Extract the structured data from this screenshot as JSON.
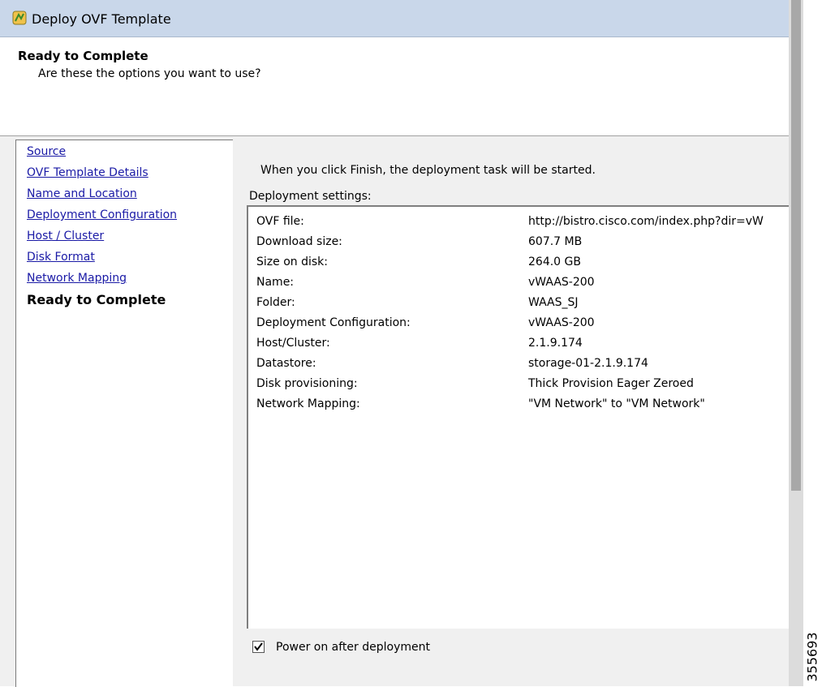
{
  "window": {
    "title": "Deploy OVF Template",
    "icon": "ovf-template-icon"
  },
  "header": {
    "title": "Ready to Complete",
    "subtitle": "Are these the options you want to use?"
  },
  "nav": {
    "items": [
      {
        "label": "Source"
      },
      {
        "label": "OVF Template Details"
      },
      {
        "label": "Name and Location"
      },
      {
        "label": "Deployment Configuration"
      },
      {
        "label": "Host / Cluster"
      },
      {
        "label": "Disk Format"
      },
      {
        "label": "Network Mapping"
      }
    ],
    "current": "Ready to Complete"
  },
  "main": {
    "intro": "When you click Finish, the deployment task will be started.",
    "settings_label": "Deployment settings:",
    "settings": [
      {
        "key": "OVF file:",
        "value": "http://bistro.cisco.com/index.php?dir=vW"
      },
      {
        "key": "Download size:",
        "value": "607.7 MB"
      },
      {
        "key": "Size on disk:",
        "value": "264.0 GB"
      },
      {
        "key": "Name:",
        "value": "vWAAS-200"
      },
      {
        "key": "Folder:",
        "value": "WAAS_SJ"
      },
      {
        "key": "Deployment Configuration:",
        "value": "vWAAS-200"
      },
      {
        "key": "Host/Cluster:",
        "value": "2.1.9.174"
      },
      {
        "key": "Datastore:",
        "value": "storage-01-2.1.9.174"
      },
      {
        "key": "Disk provisioning:",
        "value": "Thick Provision Eager Zeroed"
      },
      {
        "key": "Network Mapping:",
        "value": "\"VM Network\" to \"VM Network\""
      }
    ],
    "power_on": {
      "label": "Power on after deployment",
      "checked": true
    }
  },
  "figure_id": "355693"
}
